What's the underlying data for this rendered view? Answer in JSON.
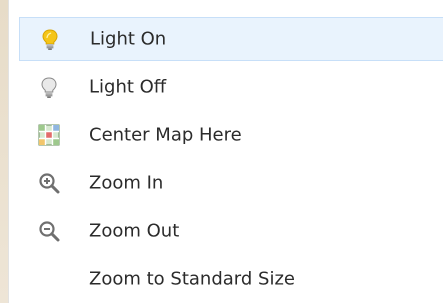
{
  "menu": {
    "items": [
      {
        "label": "Light On",
        "icon": "light-bulb-on-icon",
        "highlighted": true
      },
      {
        "label": "Light Off",
        "icon": "light-bulb-off-icon",
        "highlighted": false
      },
      {
        "label": "Center Map Here",
        "icon": "map-grid-icon",
        "highlighted": false
      },
      {
        "label": "Zoom In",
        "icon": "zoom-in-icon",
        "highlighted": false
      },
      {
        "label": "Zoom Out",
        "icon": "zoom-out-icon",
        "highlighted": false
      },
      {
        "label": "Zoom to Standard Size",
        "icon": "",
        "highlighted": false
      }
    ]
  },
  "colors": {
    "highlight_bg": "#e9f3fd",
    "highlight_border": "#c7dff8",
    "bulb_on": "#f5c518",
    "icon_gray": "#7a7a7a"
  }
}
